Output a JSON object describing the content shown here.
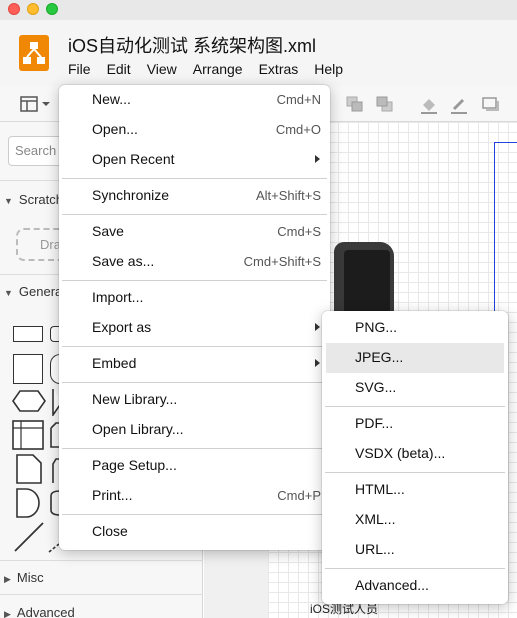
{
  "window": {
    "title": "iOS自动化测试 系统架构图.xml"
  },
  "menubar": [
    "File",
    "Edit",
    "View",
    "Arrange",
    "Extras",
    "Help"
  ],
  "sidebar": {
    "search_placeholder": "Search",
    "sections": [
      "Scratchpad",
      "General",
      "Misc",
      "Advanced"
    ],
    "drag_label": "Drag"
  },
  "canvas": {
    "caption": "iOS测试人员"
  },
  "file_menu": [
    {
      "label": "New...",
      "shortcut": "Cmd+N"
    },
    {
      "label": "Open...",
      "shortcut": "Cmd+O"
    },
    {
      "label": "Open Recent",
      "shortcut": ""
    },
    {
      "label": "Synchronize",
      "shortcut": "Alt+Shift+S"
    },
    {
      "label": "Save",
      "shortcut": "Cmd+S"
    },
    {
      "label": "Save as...",
      "shortcut": "Cmd+Shift+S"
    },
    {
      "label": "Import...",
      "shortcut": ""
    },
    {
      "label": "Export as",
      "shortcut": ""
    },
    {
      "label": "Embed",
      "shortcut": ""
    },
    {
      "label": "New Library...",
      "shortcut": ""
    },
    {
      "label": "Open Library...",
      "shortcut": ""
    },
    {
      "label": "Page Setup...",
      "shortcut": ""
    },
    {
      "label": "Print...",
      "shortcut": "Cmd+P"
    },
    {
      "label": "Close",
      "shortcut": ""
    }
  ],
  "export_menu": [
    {
      "label": "PNG..."
    },
    {
      "label": "JPEG...",
      "highlighted": true
    },
    {
      "label": "SVG..."
    },
    {
      "label": "PDF..."
    },
    {
      "label": "VSDX (beta)..."
    },
    {
      "label": "HTML..."
    },
    {
      "label": "XML..."
    },
    {
      "label": "URL..."
    },
    {
      "label": "Advanced..."
    }
  ],
  "colors": {
    "logo": "#f08705",
    "highlight": "#e8e8e8",
    "canvas_border": "#2244dd"
  }
}
